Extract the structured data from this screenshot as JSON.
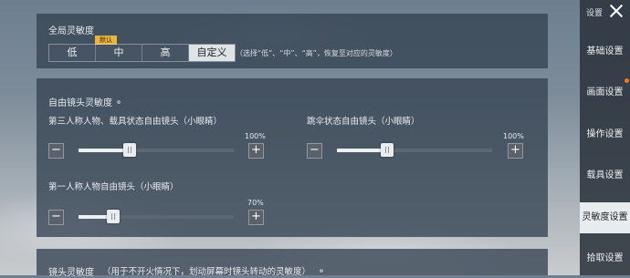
{
  "global_sensitivity": {
    "title": "全局灵敏度",
    "default_tag": "默认",
    "options": [
      "低",
      "中",
      "高",
      "自定义"
    ],
    "selected": "自定义",
    "hint": "（选择“低”、“中”、“高”，恢复至对应的灵敏度）"
  },
  "free_look": {
    "title": "自由镜头灵敏度",
    "third_person": {
      "label": "第三人称人物、载具状态自由镜头（小眼睛）",
      "value_label": "100%",
      "level": 0.28
    },
    "parachute": {
      "label": "跳伞状态自由镜头（小眼睛）",
      "value_label": "100%",
      "level": 0.28
    },
    "first_person": {
      "label": "第一人称人物自由镜头（小眼睛）",
      "value_label": "70%",
      "level": 0.23
    },
    "minus": "−",
    "plus": "+"
  },
  "camera_sensitivity": {
    "title": "镜头灵敏度",
    "desc": "（用于不开火情况下，划动屏幕时镜头转动的灵敏度）"
  },
  "sidebar": {
    "title": "设置",
    "items": [
      "基础设置",
      "画面设置",
      "操作设置",
      "载具设置",
      "灵敏度设置",
      "拾取设置"
    ],
    "active": "灵敏度设置"
  },
  "colors": {
    "accent": "#e8b63a",
    "notification": "#e77a2c"
  }
}
